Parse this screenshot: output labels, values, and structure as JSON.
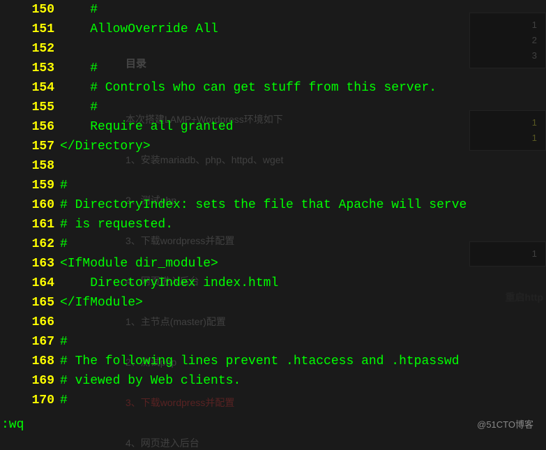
{
  "editor": {
    "lines": [
      {
        "num": "150",
        "text": "    #"
      },
      {
        "num": "151",
        "text": "    AllowOverride All"
      },
      {
        "num": "152",
        "text": ""
      },
      {
        "num": "153",
        "text": "    #"
      },
      {
        "num": "154",
        "text": "    # Controls who can get stuff from this server."
      },
      {
        "num": "155",
        "text": "    #"
      },
      {
        "num": "156",
        "text": "    Require all granted"
      },
      {
        "num": "157",
        "text": "</Directory>"
      },
      {
        "num": "158",
        "text": ""
      },
      {
        "num": "159",
        "text": "#"
      },
      {
        "num": "160",
        "text": "# DirectoryIndex: sets the file that Apache will serve"
      },
      {
        "num": "161",
        "text": "# is requested."
      },
      {
        "num": "162",
        "text": "#"
      },
      {
        "num": "163",
        "text": "<IfModule dir_module>"
      },
      {
        "num": "164",
        "text": "    DirectoryIndex index.html"
      },
      {
        "num": "165",
        "text": "</IfModule>"
      },
      {
        "num": "166",
        "text": ""
      },
      {
        "num": "167",
        "text": "#"
      },
      {
        "num": "168",
        "text": "# The following lines prevent .htaccess and .htpasswd "
      },
      {
        "num": "169",
        "text": "# viewed by Web clients."
      },
      {
        "num": "170",
        "text": "#"
      }
    ],
    "status": ":wq"
  },
  "background": {
    "toc_title": "目录",
    "toc_intro": "本次搭建LAMP+Wordpress环境如下",
    "toc_items": [
      {
        "text": "1、安装mariadb、php、httpd、wget",
        "red": false
      },
      {
        "text": "2、测试php",
        "red": false
      },
      {
        "text": "3、下载wordpress并配置",
        "red": false
      },
      {
        "text": "4、网页进入后台",
        "red": false
      },
      {
        "text": "1、主节点(master)配置",
        "red": false
      },
      {
        "text": "2、测试php",
        "red": false
      },
      {
        "text": "3、下载wordpress并配置",
        "red": true
      },
      {
        "text": "4、网页进入后台",
        "red": false
      }
    ],
    "side_label": "重启http",
    "sideboxes": [
      {
        "nums": [
          "1",
          "2",
          "3"
        ]
      },
      {
        "nums": [
          "1",
          "1"
        ]
      },
      {
        "nums": [
          "1"
        ]
      }
    ]
  },
  "watermark": "@51CTO博客"
}
